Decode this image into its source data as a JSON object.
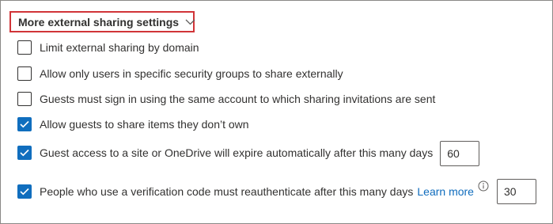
{
  "section": {
    "title": "More external sharing settings",
    "expanded": true
  },
  "settings": [
    {
      "label": "Limit external sharing by domain",
      "checked": false
    },
    {
      "label": "Allow only users in specific security groups to share externally",
      "checked": false
    },
    {
      "label": "Guests must sign in using the same account to which sharing invitations are sent",
      "checked": false
    },
    {
      "label": "Allow guests to share items they don’t own",
      "checked": true
    },
    {
      "label": "Guest access to a site or OneDrive will expire automatically after this many days",
      "checked": true,
      "value": "60"
    },
    {
      "label": "People who use a verification code must reauthenticate after this many days",
      "checked": true,
      "link": "Learn more",
      "value": "30"
    }
  ],
  "icons": {
    "chevron": "chevron-down-icon",
    "checkmark": "checkmark-icon",
    "info": "info-icon"
  },
  "colors": {
    "highlight_border": "#d13438",
    "checkbox_checked": "#106ebe",
    "link": "#0f6cbd",
    "text": "#323130"
  }
}
